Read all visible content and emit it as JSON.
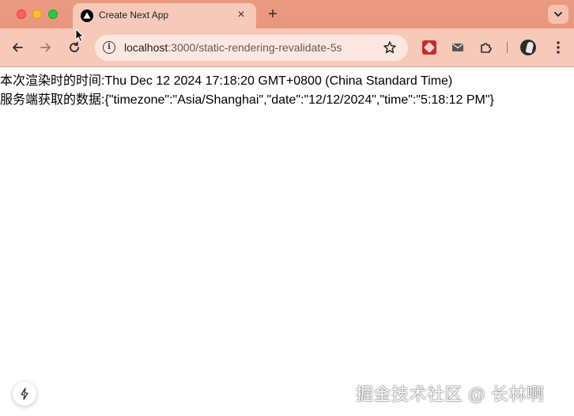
{
  "window": {
    "tab_title": "Create Next App"
  },
  "toolbar": {
    "url_host": "localhost",
    "url_path": ":3000/static-rendering-revalidate-5s"
  },
  "page": {
    "line1": "本次渲染时的时间:Thu Dec 12 2024 17:18:20 GMT+0800 (China Standard Time)",
    "line2": "服务端获取的数据:{\"timezone\":\"Asia/Shanghai\",\"date\":\"12/12/2024\",\"time\":\"5:18:12 PM\"}"
  },
  "watermark": "掘金技术社区 @ 长林啊",
  "icons": {
    "tab_favicon": "nextjs-triangle-icon",
    "close": "close-icon",
    "new_tab": "plus-icon",
    "tab_menu": "chevron-down-icon",
    "back": "arrow-left-icon",
    "forward": "arrow-right-icon",
    "reload": "reload-icon",
    "site_info": "info-icon",
    "bookmark": "star-icon",
    "extension_1": "red-extension-icon",
    "extension_2": "mail-icon",
    "extensions": "puzzle-icon",
    "profile": "avatar",
    "menu": "kebab-icon",
    "dev_indicator": "lightning-icon"
  },
  "colors": {
    "chrome_frame": "#e9967a",
    "active_tab": "#f6c9b9",
    "omnibox": "#fbe7e0"
  }
}
